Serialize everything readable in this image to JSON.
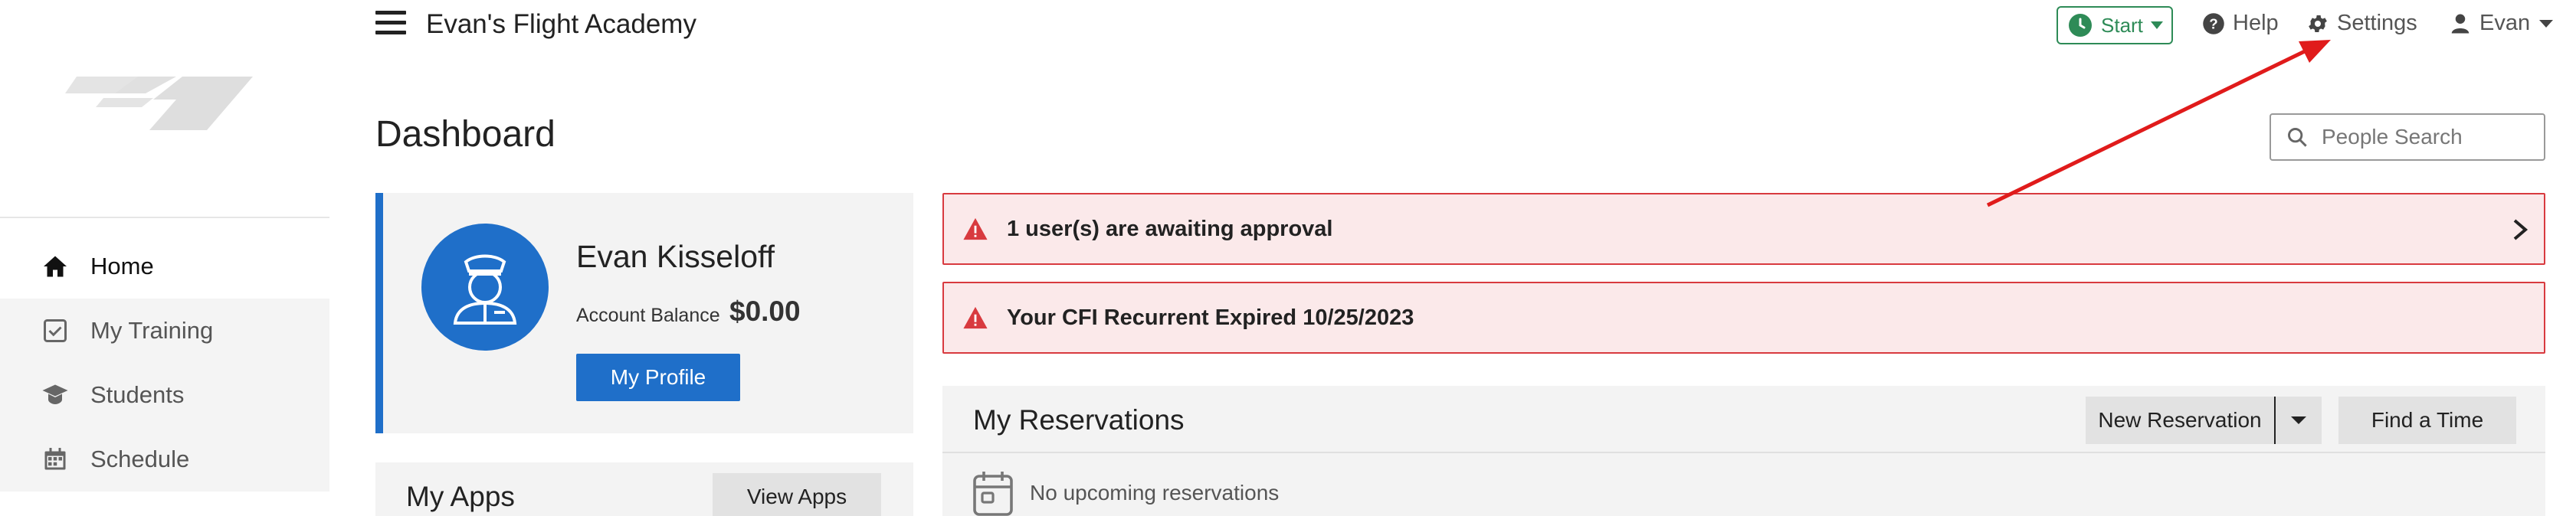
{
  "header": {
    "app_title": "Evan's Flight Academy",
    "start_label": "Start",
    "help_label": "Help",
    "settings_label": "Settings",
    "user_label": "Evan"
  },
  "sidebar": {
    "items": [
      {
        "label": "Home",
        "icon": "home-icon",
        "active": true
      },
      {
        "label": "My Training",
        "icon": "checkbox-icon",
        "active": false
      },
      {
        "label": "Students",
        "icon": "graduation-cap-icon",
        "active": false
      },
      {
        "label": "Schedule",
        "icon": "calendar-icon",
        "active": false
      }
    ]
  },
  "main": {
    "page_title": "Dashboard",
    "people_search_placeholder": "People Search",
    "profile": {
      "name": "Evan Kisseloff",
      "balance_label": "Account Balance",
      "balance_value": "$0.00",
      "my_profile_label": "My Profile"
    },
    "apps": {
      "title": "My Apps",
      "view_apps_label": "View Apps"
    },
    "alerts": [
      {
        "text": "1 user(s) are awaiting approval"
      },
      {
        "text": "Your CFI Recurrent Expired 10/25/2023"
      }
    ],
    "reservations": {
      "title": "My Reservations",
      "new_reservation_label": "New Reservation",
      "find_time_label": "Find a Time",
      "empty_text": "No upcoming reservations"
    }
  },
  "colors": {
    "brand_blue": "#1f6fc9",
    "start_green": "#2e8b57",
    "alert_red": "#d83a3f",
    "alert_bg": "#fbe9ea",
    "annotation_arrow": "#e01b1b"
  }
}
